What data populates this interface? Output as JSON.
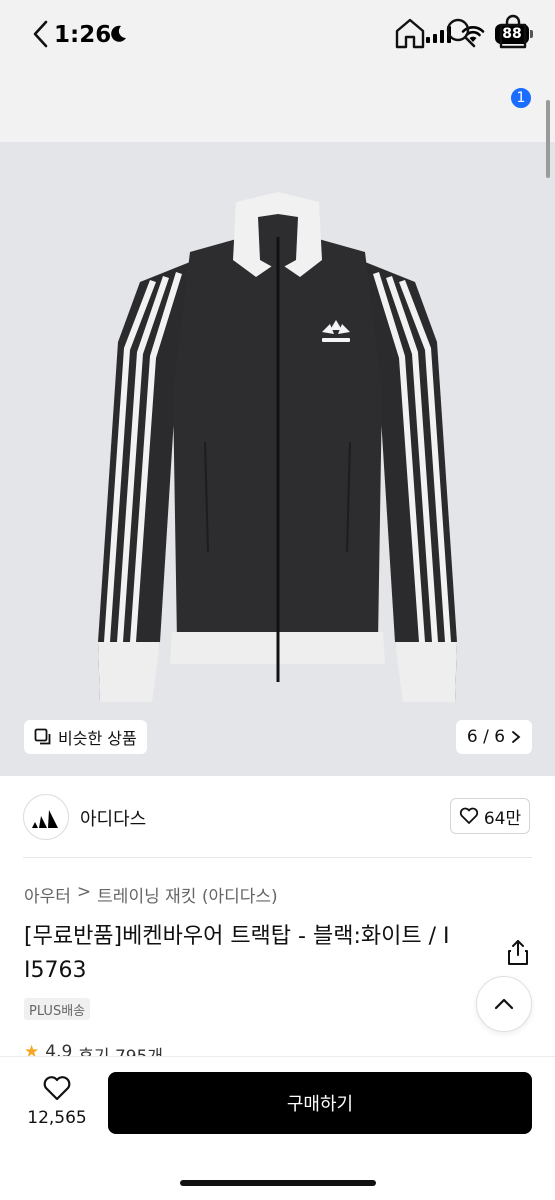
{
  "status_bar": {
    "time": "1:26",
    "battery": "88"
  },
  "nav": {
    "cart_count": "1"
  },
  "gallery": {
    "similar_label": "비슷한 상품",
    "page_counter": "6 / 6"
  },
  "brand": {
    "name": "아디다스",
    "likes": "64만"
  },
  "breadcrumb": {
    "category": "아우터",
    "separator": ">",
    "subcategory": "트레이닝 재킷 (아디다스)"
  },
  "product": {
    "title": "[무료반품]베켄바우어 트랙탑 - 블랙:화이트 / I I5763",
    "shipping_badge": "PLUS배송",
    "rating": "4.9",
    "reviews": "후기 795개"
  },
  "bottom_bar": {
    "wish_count": "12,565",
    "buy_label": "구매하기"
  },
  "colors": {
    "accent_badge": "#1a6dff",
    "buy_button": "#000000",
    "star": "#f5a623",
    "image_bg": "#e4e5e9"
  }
}
